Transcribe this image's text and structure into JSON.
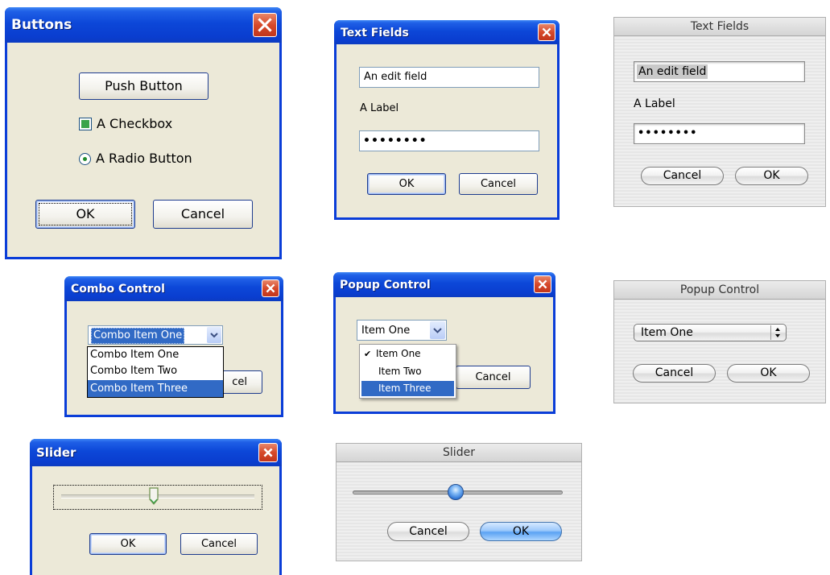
{
  "buttons_window": {
    "title": "Buttons",
    "push_button": "Push Button",
    "checkbox_label": "A Checkbox",
    "radio_label": "A Radio Button",
    "ok": "OK",
    "cancel": "Cancel"
  },
  "text_fields_xp": {
    "title": "Text Fields",
    "edit_value": "An edit field",
    "label": "A Label",
    "password_value": "••••••••",
    "ok": "OK",
    "cancel": "Cancel"
  },
  "text_fields_mac": {
    "title": "Text Fields",
    "edit_value": "An edit field",
    "label": "A Label",
    "password_value": "••••••••",
    "cancel": "Cancel",
    "ok": "OK"
  },
  "combo_window": {
    "title": "Combo Control",
    "selected": "Combo Item One",
    "items": [
      "Combo Item One",
      "Combo Item Two",
      "Combo Item Three"
    ],
    "highlighted_index": 2,
    "cancel_partial": "cel"
  },
  "popup_xp": {
    "title": "Popup Control",
    "selected": "Item One",
    "items": [
      "Item One",
      "Item Two",
      "Item Three"
    ],
    "checked_index": 0,
    "highlighted_index": 2,
    "cancel": "Cancel"
  },
  "popup_mac": {
    "title": "Popup Control",
    "selected": "Item One",
    "cancel": "Cancel",
    "ok": "OK"
  },
  "slider_xp": {
    "title": "Slider",
    "value_fraction": 0.48,
    "ok": "OK",
    "cancel": "Cancel"
  },
  "slider_mac": {
    "title": "Slider",
    "value_fraction": 0.49,
    "cancel": "Cancel",
    "ok": "OK"
  },
  "colors": {
    "xp_title_blue": "#0c47d8",
    "xp_face": "#ece9d8",
    "xp_close_red": "#d6492a",
    "menu_highlight": "#316ac5",
    "mac_blue_button": "#5aa2f3"
  }
}
